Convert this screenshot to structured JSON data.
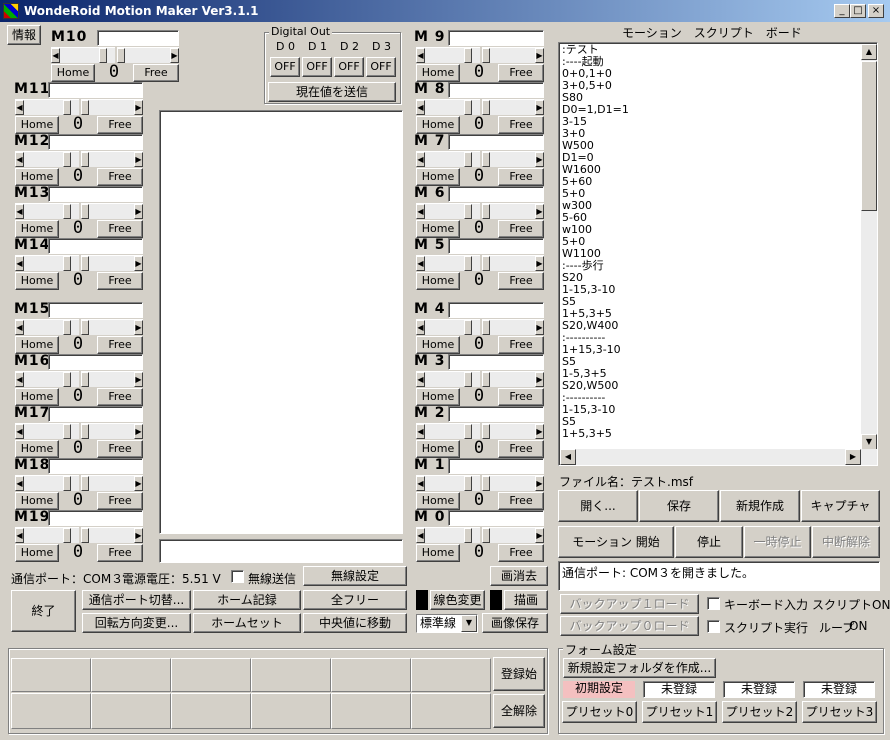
{
  "window": {
    "title": "WondeRoid Motion Maker Ver3.1.1",
    "min": "_",
    "max": "□",
    "close": "×"
  },
  "info_button": "情報",
  "slider": {
    "home": "Home",
    "free": "Free",
    "value": "0"
  },
  "motors_left": [
    {
      "id": "m10",
      "label": "M10"
    },
    {
      "id": "m11",
      "label": "M11"
    },
    {
      "id": "m12",
      "label": "M12"
    },
    {
      "id": "m13",
      "label": "M13"
    },
    {
      "id": "m14",
      "label": "M14"
    },
    {
      "id": "m15",
      "label": "M15"
    },
    {
      "id": "m16",
      "label": "M16"
    },
    {
      "id": "m17",
      "label": "M17"
    },
    {
      "id": "m18",
      "label": "M18"
    },
    {
      "id": "m19",
      "label": "M19"
    }
  ],
  "motors_right": [
    {
      "id": "m9",
      "label": "M 9"
    },
    {
      "id": "m8",
      "label": "M 8"
    },
    {
      "id": "m7",
      "label": "M 7"
    },
    {
      "id": "m6",
      "label": "M 6"
    },
    {
      "id": "m5",
      "label": "M 5"
    },
    {
      "id": "m4",
      "label": "M 4"
    },
    {
      "id": "m3",
      "label": "M 3"
    },
    {
      "id": "m2",
      "label": "M 2"
    },
    {
      "id": "m1",
      "label": "M 1"
    },
    {
      "id": "m0",
      "label": "M 0"
    }
  ],
  "digital_out": {
    "title": "Digital Out",
    "channels": [
      {
        "label": "D 0",
        "state": "OFF"
      },
      {
        "label": "D 1",
        "state": "OFF"
      },
      {
        "label": "D 2",
        "state": "OFF"
      },
      {
        "label": "D 3",
        "state": "OFF"
      }
    ],
    "send_button": "現在値を送信"
  },
  "script_board": {
    "title": "モーション　スクリプト　ボード",
    "lines": [
      ":テスト",
      ":----起動",
      "0+0,1+0",
      "3+0,5+0",
      "S80",
      "D0=1,D1=1",
      "3-15",
      "3+0",
      "W500",
      "D1=0",
      "W1600",
      "5+60",
      "5+0",
      "w300",
      "5-60",
      "w100",
      "5+0",
      "W1100",
      ":----歩行",
      "S20",
      "1-15,3-10",
      "S5",
      "1+5,3+5",
      "S20,W400",
      ":----------",
      "1+15,3-10",
      "S5",
      "1-5,3+5",
      "S20,W500",
      ":----------",
      "1-15,3-10",
      "S5",
      "1+5,3+5"
    ]
  },
  "file": {
    "label": "ファイル名：",
    "name": "テスト.msf"
  },
  "file_buttons": {
    "open": "開く...",
    "save": "保存",
    "new": "新規作成",
    "capture": "キャプチャ"
  },
  "motion_buttons": {
    "start": "モーション 開始",
    "stop": "停止",
    "pause": "一時停止",
    "resume": "中断解除"
  },
  "status_message": "通信ポート: COM３を開きました。",
  "status_bar": {
    "port": "通信ポート：COM３",
    "voltage": "電源電圧：5.51 V",
    "wireless_send": "無線送信"
  },
  "buttons": {
    "wireless_settings": "無線設定",
    "clear_screen": "画消去",
    "exit": "終了",
    "switch_port": "通信ポート切替...",
    "home_record": "ホーム記録",
    "all_free": "全フリー",
    "line_color": "線色変更",
    "draw": "描画",
    "rotation": "回転方向変更...",
    "home_set": "ホームセット",
    "center_move": "中央値に移動",
    "save_image": "画像保存",
    "register_start": "登録始",
    "release_all": "全解除"
  },
  "line_type": "標準線",
  "backup": {
    "load1": "バックアップ１ロード",
    "load0": "バックアップ０ロード"
  },
  "options": {
    "keyboard_input": "キーボード入力",
    "script_on": "スクリプトON",
    "script_exec": "スクリプト実行",
    "loop_label": "ループ",
    "loop_state": "ON"
  },
  "form_settings": {
    "title": "フォーム設定",
    "new_folder": "新規設定フォルダを作成...",
    "slots": [
      "初期設定",
      "未登録",
      "未登録",
      "未登録"
    ],
    "presets": [
      "プリセット0",
      "プリセット1",
      "プリセット2",
      "プリセット3"
    ]
  },
  "colors": {
    "title_start": "#0a246a",
    "title_end": "#a6caf0",
    "face": "#d4d0c8",
    "preset_active": "#f4c0c0"
  }
}
